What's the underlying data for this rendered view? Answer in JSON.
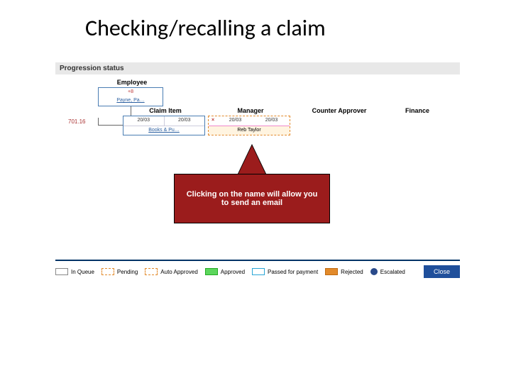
{
  "title": "Checking/recalling a claim",
  "section_header": "Progression status",
  "columns": {
    "employee": "Employee",
    "claim_item": "Claim Item",
    "manager": "Manager",
    "counter_approver": "Counter Approver",
    "finance": "Finance"
  },
  "employee": {
    "badge_count": "+8",
    "name": "Payne, Pa…"
  },
  "row_number": "701.16",
  "claim_item": {
    "date_left": "20/03",
    "date_right": "20/03",
    "name": "Books & Pu…"
  },
  "manager": {
    "date_left": "20/03",
    "date_right": "20/03",
    "name": "Reb Taylor"
  },
  "callout": "Clicking on the name will allow you to send an email",
  "legend": {
    "in_queue": "In Queue",
    "pending": "Pending",
    "auto_approved": "Auto Approved",
    "approved": "Approved",
    "passed": "Passed for payment",
    "rejected": "Rejected",
    "escalated": "Escalated"
  },
  "close_label": "Close"
}
